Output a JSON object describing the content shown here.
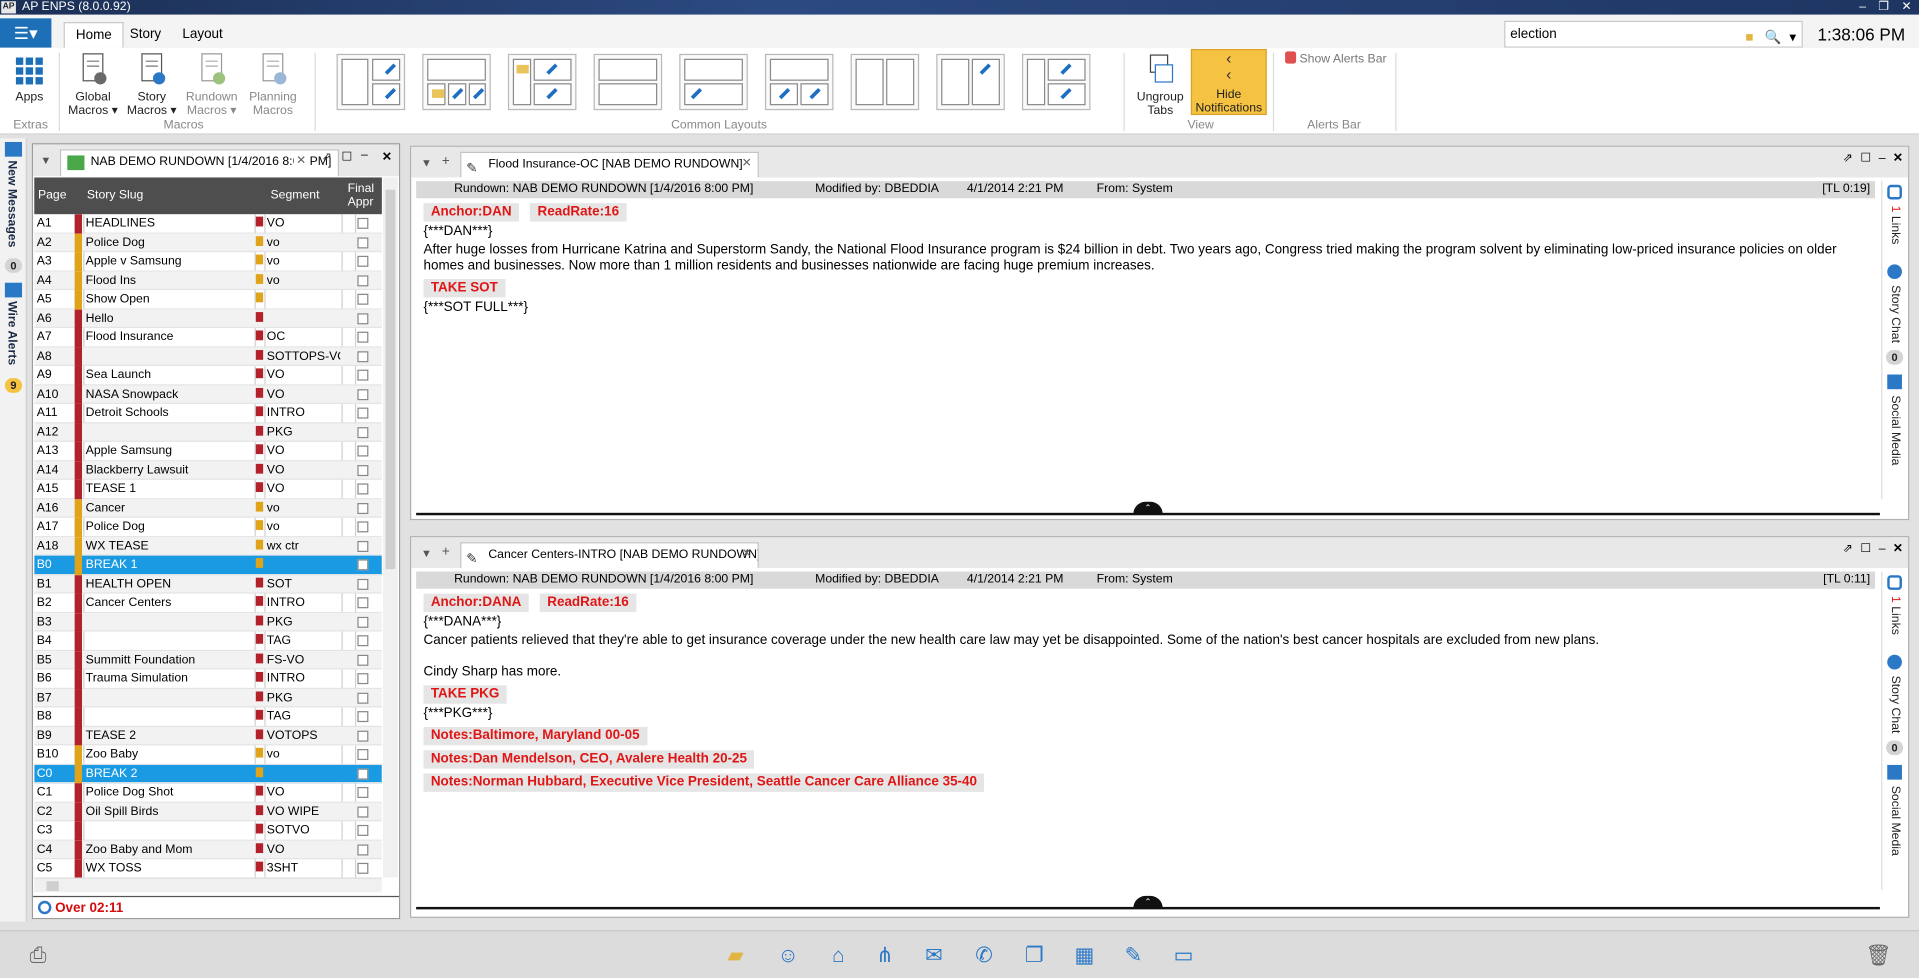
{
  "app": {
    "title": "AP ENPS (8.0.0.92)",
    "logo": "AP"
  },
  "tabs": [
    "Home",
    "Story",
    "Layout"
  ],
  "search": {
    "value": "election"
  },
  "clock": "1:38:06 PM",
  "ribbon": {
    "apps": "Apps",
    "extras": "Extras",
    "macros": [
      {
        "l1": "Global",
        "l2": "Macros ▾"
      },
      {
        "l1": "Story",
        "l2": "Macros ▾"
      },
      {
        "l1": "Rundown",
        "l2": "Macros ▾"
      },
      {
        "l1": "Planning",
        "l2": "Macros"
      }
    ],
    "macros_group": "Macros",
    "layouts_group": "Common Layouts",
    "ungroup": {
      "l1": "Ungroup",
      "l2": "Tabs"
    },
    "hide": {
      "l1": "Hide",
      "l2": "Notifications"
    },
    "view_group": "View",
    "alerts_btn": "Show Alerts Bar",
    "alerts_group": "Alerts Bar"
  },
  "leftstrip": {
    "messages": "New Messages",
    "messages_count": "0",
    "wire": "Wire Alerts",
    "wire_count": "9"
  },
  "rundown": {
    "tab": "NAB DEMO RUNDOWN [1/4/2016 8:00 PM]",
    "headers": {
      "page": "Page",
      "slug": "Story Slug",
      "segment": "Segment",
      "final1": "Final",
      "final2": "Appr"
    },
    "rows": [
      {
        "page": "A1",
        "slug": "HEADLINES",
        "seg": "VO",
        "mark": "red",
        "m2": "red"
      },
      {
        "page": "A2",
        "slug": "Police Dog",
        "seg": "vo",
        "mark": "yellow",
        "m2": "yellow"
      },
      {
        "page": "A3",
        "slug": "Apple v Samsung",
        "seg": "vo",
        "mark": "yellow",
        "m2": "yellow"
      },
      {
        "page": "A4",
        "slug": "Flood Ins",
        "seg": "vo",
        "mark": "yellow",
        "m2": "yellow"
      },
      {
        "page": "A5",
        "slug": "Show Open",
        "seg": "",
        "mark": "yellow",
        "m2": "yellow"
      },
      {
        "page": "A6",
        "slug": "Hello",
        "seg": "",
        "mark": "red",
        "m2": "red"
      },
      {
        "page": "A7",
        "slug": "Flood Insurance",
        "seg": "OC",
        "mark": "red",
        "m2": "red"
      },
      {
        "page": "A8",
        "slug": "",
        "seg": "SOTTOPS-VO",
        "mark": "red",
        "m2": "red"
      },
      {
        "page": "A9",
        "slug": "Sea Launch",
        "seg": "VO",
        "mark": "red",
        "m2": "red"
      },
      {
        "page": "A10",
        "slug": "NASA Snowpack",
        "seg": "VO",
        "mark": "red",
        "m2": "red"
      },
      {
        "page": "A11",
        "slug": "Detroit Schools",
        "seg": "INTRO",
        "mark": "red",
        "m2": "red"
      },
      {
        "page": "A12",
        "slug": "",
        "seg": "PKG",
        "mark": "red",
        "m2": "red"
      },
      {
        "page": "A13",
        "slug": "Apple Samsung",
        "seg": "VO",
        "mark": "red",
        "m2": "red"
      },
      {
        "page": "A14",
        "slug": "Blackberry Lawsuit",
        "seg": "VO",
        "mark": "red",
        "m2": "red"
      },
      {
        "page": "A15",
        "slug": "TEASE 1",
        "seg": "VO",
        "mark": "red",
        "m2": "red"
      },
      {
        "page": "A16",
        "slug": "Cancer",
        "seg": "vo",
        "mark": "yellow",
        "m2": "yellow"
      },
      {
        "page": "A17",
        "slug": "Police Dog",
        "seg": "vo",
        "mark": "yellow",
        "m2": "yellow"
      },
      {
        "page": "A18",
        "slug": "WX TEASE",
        "seg": "wx ctr",
        "mark": "yellow",
        "m2": "yellow"
      },
      {
        "page": "B0",
        "slug": "BREAK 1",
        "seg": "",
        "mark": "yellow",
        "m2": "yellow",
        "sel": true
      },
      {
        "page": "B1",
        "slug": "HEALTH OPEN",
        "seg": "SOT",
        "mark": "red",
        "m2": "red"
      },
      {
        "page": "B2",
        "slug": "Cancer Centers",
        "seg": "INTRO",
        "mark": "red",
        "m2": "red"
      },
      {
        "page": "B3",
        "slug": "",
        "seg": "PKG",
        "mark": "red",
        "m2": "red"
      },
      {
        "page": "B4",
        "slug": "",
        "seg": "TAG",
        "mark": "red",
        "m2": "red"
      },
      {
        "page": "B5",
        "slug": "Summitt Foundation",
        "seg": "FS-VO",
        "mark": "red",
        "m2": "red"
      },
      {
        "page": "B6",
        "slug": "Trauma Simulation",
        "seg": "INTRO",
        "mark": "red",
        "m2": "red"
      },
      {
        "page": "B7",
        "slug": "",
        "seg": "PKG",
        "mark": "red",
        "m2": "red"
      },
      {
        "page": "B8",
        "slug": "",
        "seg": "TAG",
        "mark": "red",
        "m2": "red"
      },
      {
        "page": "B9",
        "slug": "TEASE 2",
        "seg": "VOTOPS",
        "mark": "red",
        "m2": "red"
      },
      {
        "page": "B10",
        "slug": "Zoo Baby",
        "seg": "vo",
        "mark": "yellow",
        "m2": "yellow"
      },
      {
        "page": "C0",
        "slug": "BREAK 2",
        "seg": "",
        "mark": "yellow",
        "m2": "yellow",
        "sel": true
      },
      {
        "page": "C1",
        "slug": "Police Dog Shot",
        "seg": "VO",
        "mark": "red",
        "m2": "red"
      },
      {
        "page": "C2",
        "slug": "Oil Spill Birds",
        "seg": "VO WIPE",
        "mark": "red",
        "m2": "red"
      },
      {
        "page": "C3",
        "slug": "",
        "seg": "SOTVO",
        "mark": "red",
        "m2": "red"
      },
      {
        "page": "C4",
        "slug": "Zoo Baby and Mom",
        "seg": "VO",
        "mark": "red",
        "m2": "red"
      },
      {
        "page": "C5",
        "slug": "WX TOSS",
        "seg": "3SHT",
        "mark": "red",
        "m2": "red"
      }
    ],
    "footer": "Over 02:11"
  },
  "story1": {
    "tab": "Flood Insurance-OC [NAB DEMO RUNDOWN]",
    "rundown": "Rundown: NAB DEMO RUNDOWN [1/4/2016 8:00 PM]",
    "modified": "Modified by: DBEDDIA",
    "date": "4/1/2014 2:21 PM",
    "from": "From: System",
    "tl": "[TL 0:19]",
    "anchor": "Anchor:DAN",
    "readrate": "ReadRate:16",
    "cue1": "{***DAN***}",
    "text": "After huge losses from Hurricane Katrina and Superstorm Sandy, the National Flood Insurance program is $24 billion in debt. Two years ago, Congress tried making the program solvent by eliminating low-priced insurance policies on older homes and businesses.  Now more than 1 million residents and businesses nationwide are facing huge premium increases.",
    "take": "TAKE SOT",
    "cue2": "{***SOT FULL***}"
  },
  "story2": {
    "tab": "Cancer Centers-INTRO [NAB DEMO RUNDOWN]",
    "rundown": "Rundown: NAB DEMO RUNDOWN [1/4/2016 8:00 PM]",
    "modified": "Modified by: DBEDDIA",
    "date": "4/1/2014 2:21 PM",
    "from": "From: System",
    "tl": "[TL 0:11]",
    "anchor": "Anchor:DANA",
    "readrate": "ReadRate:16",
    "cue1": "{***DANA***}",
    "text": "Cancer patients relieved that they're able to get insurance coverage under the new health care law may yet be disappointed. Some of the nation's best cancer hospitals are excluded from new plans.",
    "text2": "Cindy Sharp has more.",
    "take": "TAKE PKG",
    "cue2": "{***PKG***}",
    "notes": [
      "Notes:Baltimore, Maryland 00-05",
      "Notes:Dan Mendelson, CEO, Avalere Health 20-25",
      "Notes:Norman Hubbard, Executive Vice President, Seattle Cancer Care Alliance 35-40"
    ]
  },
  "sidebar": {
    "links": "Links",
    "links_count": "1",
    "chat": "Story Chat",
    "chat_count": "0",
    "social": "Social Media"
  },
  "colors": {
    "accent": "#1a9ae2",
    "alert": "#e01616",
    "mark_red": "#b3212b",
    "mark_yellow": "#e0a41a",
    "highlight": "#f5c242"
  }
}
